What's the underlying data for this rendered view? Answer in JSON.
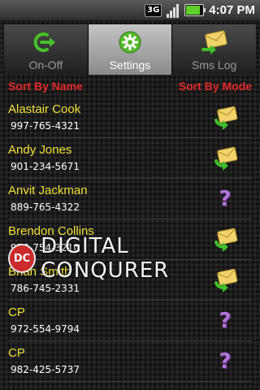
{
  "status_bar": {
    "network": "3G",
    "time": "4:07 PM",
    "icons": [
      "3g-data-icon",
      "signal-strength-icon",
      "battery-icon"
    ]
  },
  "tabs": [
    {
      "label": "On-Off",
      "icon": "power-arrow-icon",
      "active": false
    },
    {
      "label": "Settings",
      "icon": "gear-icon",
      "active": true
    },
    {
      "label": "Sms Log",
      "icon": "envelope-arrow-icon",
      "active": false
    }
  ],
  "sort": {
    "by_name": "Sort By Name",
    "by_mode": "Sort By Mode"
  },
  "contacts": [
    {
      "name": "Alastair Cook",
      "phone": "997-765-4321",
      "mode_icon": "envelope-reply-icon"
    },
    {
      "name": "Andy Jones",
      "phone": "901-234-5671",
      "mode_icon": "envelope-reply-icon"
    },
    {
      "name": "Anvit Jackman",
      "phone": "889-765-4322",
      "mode_icon": "question-mark-icon"
    },
    {
      "name": "Brendon Collins",
      "phone": "976-754-3210",
      "mode_icon": "envelope-reply-icon"
    },
    {
      "name": "Brian Smith",
      "phone": "786-745-2331",
      "mode_icon": "envelope-reply-icon"
    },
    {
      "name": "CP",
      "phone": "972-554-9794",
      "mode_icon": "question-mark-icon"
    },
    {
      "name": "CP",
      "phone": "982-425-5737",
      "mode_icon": "question-mark-icon"
    }
  ],
  "watermark": {
    "logo": "DC",
    "text": "DIGITAL CONQURER"
  },
  "colors": {
    "contact_name": "#f3e03a",
    "sort_header": "#e52a2a",
    "question_icon": "#b074d8",
    "envelope": "#f1d36b",
    "arrow_green": "#3fbf2a"
  }
}
